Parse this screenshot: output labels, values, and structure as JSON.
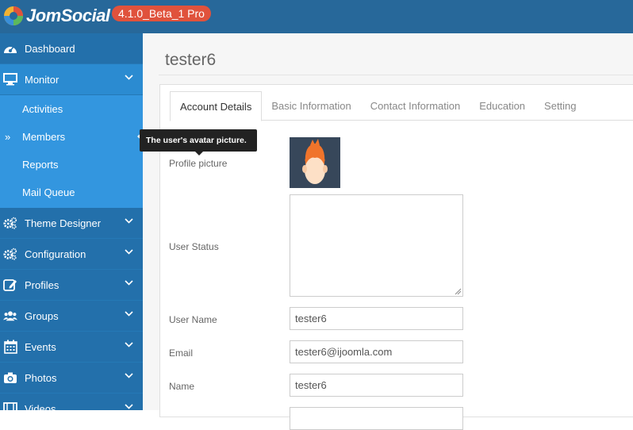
{
  "app": {
    "logo_text": "JomSocial",
    "version_badge": "4.1.0_Beta_1 Pro"
  },
  "sidebar": {
    "items": [
      {
        "label": "Dashboard",
        "icon": "dashboard-icon"
      },
      {
        "label": "Monitor",
        "icon": "monitor-icon",
        "expanded": true,
        "children": [
          {
            "label": "Activities"
          },
          {
            "label": "Members",
            "active": true,
            "bullet": "»"
          },
          {
            "label": "Reports"
          },
          {
            "label": "Mail Queue"
          }
        ]
      },
      {
        "label": "Theme Designer",
        "icon": "gears-icon"
      },
      {
        "label": "Configuration",
        "icon": "gears-icon"
      },
      {
        "label": "Profiles",
        "icon": "edit-icon"
      },
      {
        "label": "Groups",
        "icon": "users-icon"
      },
      {
        "label": "Events",
        "icon": "calendar-icon"
      },
      {
        "label": "Photos",
        "icon": "camera-icon"
      },
      {
        "label": "Videos",
        "icon": "film-icon"
      }
    ]
  },
  "page": {
    "title": "tester6"
  },
  "tabs": [
    {
      "label": "Account Details",
      "active": true
    },
    {
      "label": "Basic Information"
    },
    {
      "label": "Contact Information"
    },
    {
      "label": "Education"
    },
    {
      "label": "Setting"
    }
  ],
  "form": {
    "profile_picture_label": "Profile picture",
    "user_status_label": "User Status",
    "user_status_value": "",
    "username_label": "User Name",
    "username_value": "tester6",
    "email_label": "Email",
    "email_value": "tester6@ijoomla.com",
    "name_label": "Name",
    "name_value": "tester6"
  },
  "tooltip": {
    "text": "The user's avatar picture."
  },
  "colors": {
    "topbar": "#27689a",
    "sidebar": "#2b8bd1",
    "badge": "#e0523c"
  }
}
